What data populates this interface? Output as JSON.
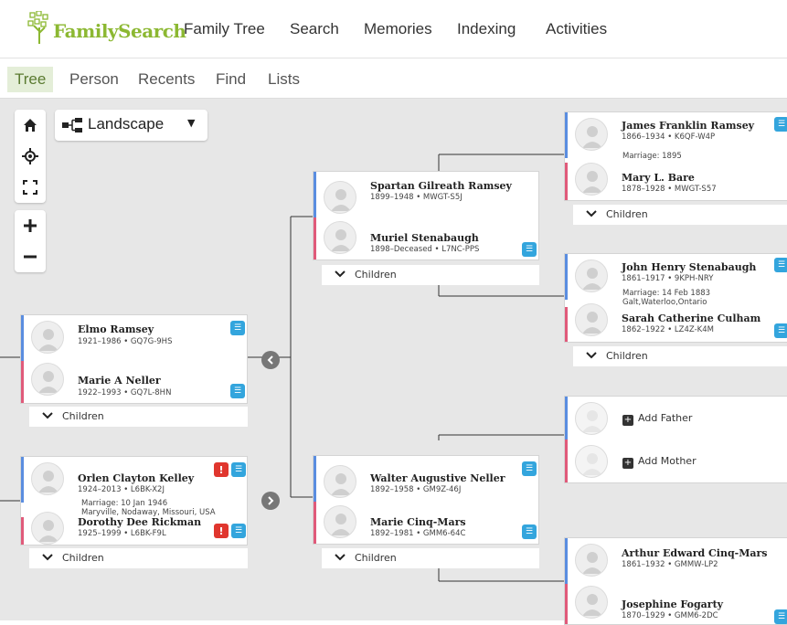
{
  "header": {
    "logo_text": "FamilySearch",
    "nav": [
      "Family Tree",
      "Search",
      "Memories",
      "Indexing",
      "Activities"
    ]
  },
  "subnav": {
    "tabs": [
      "Tree",
      "Person",
      "Recents",
      "Find",
      "Lists"
    ],
    "active": "Tree"
  },
  "controls": {
    "view_label": "Landscape"
  },
  "labels": {
    "children": "Children",
    "add_father": "Add Father",
    "add_mother": "Add Mother"
  },
  "people": {
    "elmo": {
      "name": "Elmo Ramsey",
      "meta": "1921–1986 • GQ7G-9HS"
    },
    "marie_neller": {
      "name": "Marie A Neller",
      "meta": "1922–1993 • GQ7L-8HN"
    },
    "orlen": {
      "name": "Orlen Clayton Kelley",
      "meta": "1924–2013 • L6BK-X2J"
    },
    "orlen_marriage": "Marriage: 10 Jan 1946",
    "orlen_place": "Maryville, Nodaway, Missouri, USA",
    "dorothy": {
      "name": "Dorothy Dee Rickman",
      "meta": "1925–1999 • L6BK-F9L"
    },
    "spartan": {
      "name": "Spartan Gilreath Ramsey",
      "meta": "1899–1948 • MWGT-S5J"
    },
    "muriel": {
      "name": "Muriel Stenabaugh",
      "meta": "1898–Deceased • L7NC-PPS"
    },
    "walter": {
      "name": "Walter Augustive Neller",
      "meta": "1892–1958 • GM9Z-46J"
    },
    "marie_cinq": {
      "name": "Marie Cinq-Mars",
      "meta": "1892–1981 • GMM6-64C"
    },
    "james": {
      "name": "James Franklin Ramsey",
      "meta": "1866–1934 • K6QF-W4P"
    },
    "james_marriage": "Marriage: 1895",
    "mary": {
      "name": "Mary L. Bare",
      "meta": "1878–1928 • MWGT-S57"
    },
    "john": {
      "name": "John Henry Stenabaugh",
      "meta": "1861–1917 • 9KPH-NRY"
    },
    "john_marriage": "Marriage: 14 Feb 1883",
    "john_place": "Galt,Waterloo,Ontario",
    "sarah": {
      "name": "Sarah Catherine Culham",
      "meta": "1862–1922 • LZ4Z-K4M"
    },
    "arthur": {
      "name": "Arthur Edward Cinq-Mars",
      "meta": "1861–1932 • GMMW-LP2"
    },
    "josephine": {
      "name": "Josephine Fogarty",
      "meta": "1870–1929 • GMM6-2DC"
    }
  },
  "colors": {
    "brand_green": "#8cb832",
    "male": "#5a8de0",
    "female": "#e05a7a",
    "record_icon": "#33a5dd",
    "alert_icon": "#e0362e"
  }
}
